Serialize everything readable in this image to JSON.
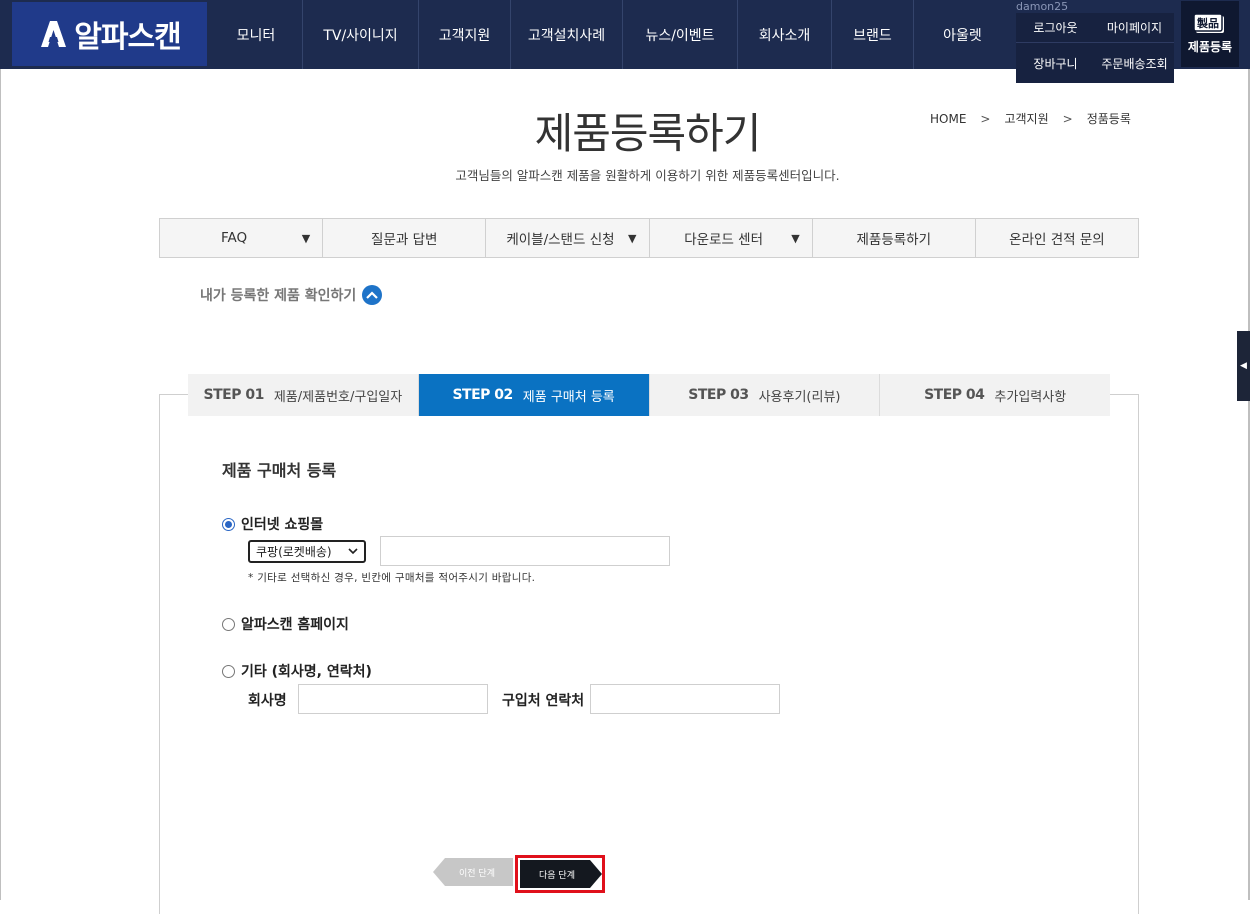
{
  "brand": {
    "name": "알파스캔"
  },
  "gnb": [
    {
      "label": "모니터",
      "w": 92
    },
    {
      "label": "TV/사이니지",
      "w": 116
    },
    {
      "label": "고객지원",
      "w": 92
    },
    {
      "label": "고객설치사례",
      "w": 112
    },
    {
      "label": "뉴스/이벤트",
      "w": 115
    },
    {
      "label": "회사소개",
      "w": 94
    },
    {
      "label": "브랜드",
      "w": 82
    },
    {
      "label": "아울렛",
      "w": 98
    }
  ],
  "util": {
    "user": "damon25",
    "logout": "로그아웃",
    "mypage": "마이페이지",
    "cart": "장바구니",
    "order": "주문배송조회",
    "product_reg": "제품등록",
    "product_reg_icon_text": "製品"
  },
  "page": {
    "title": "제품등록하기",
    "subtitle": "고객님들의 알파스캔 제품을 원활하게 이용하기 위한 제품등록센터입니다.",
    "breadcrumb": [
      "HOME",
      "고객지원",
      "정품등록"
    ]
  },
  "subnav": [
    {
      "label": "FAQ",
      "caret": "▼"
    },
    {
      "label": "질문과 답변",
      "caret": ""
    },
    {
      "label": "케이블/스탠드 신청",
      "caret": "▼"
    },
    {
      "label": "다운로드 센터",
      "caret": "▼"
    },
    {
      "label": "제품등록하기",
      "caret": ""
    },
    {
      "label": "온라인 견적 문의",
      "caret": ""
    }
  ],
  "my_products": "내가 등록한 제품 확인하기",
  "steps": [
    {
      "num": "STEP 01",
      "label": "제품/제품번호/구입일자",
      "active": false
    },
    {
      "num": "STEP 02",
      "label": "제품 구매처 등록",
      "active": true
    },
    {
      "num": "STEP 03",
      "label": "사용후기(리뷰)",
      "active": false
    },
    {
      "num": "STEP 04",
      "label": "추가입력사항",
      "active": false
    }
  ],
  "form": {
    "section_title": "제품 구매처 등록",
    "opt_online": "인터넷 쇼핑몰",
    "online_select": "쿠팡(로켓배송)",
    "online_note": "* 기타로 선택하신 경우, 빈칸에 구매처를 적어주시기 바랍니다.",
    "opt_homepage": "알파스캔 홈페이지",
    "opt_other": "기타 (회사명, 연락처)",
    "company_label": "회사명",
    "contact_label": "구입처 연락처",
    "selected": "online"
  },
  "buttons": {
    "prev": "이전 단계",
    "next": "다음 단계"
  }
}
